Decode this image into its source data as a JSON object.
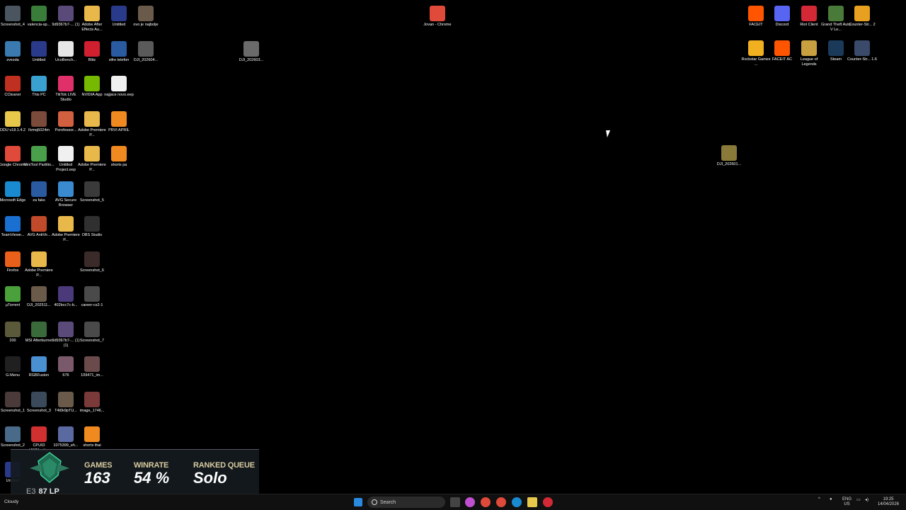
{
  "desktop_icons": [
    {
      "label": "Screenshot_4",
      "color": "#4a5560"
    },
    {
      "label": "valencia-sp...",
      "color": "#3a7d3a"
    },
    {
      "label": "9d9367b7-... (1)",
      "color": "#5a4a7a"
    },
    {
      "label": "Adobe After Effects Au...",
      "color": "#e8b84a"
    },
    {
      "label": "Untitled",
      "color": "#2a3a8a"
    },
    {
      "label": "ovo je najbolje",
      "color": "#6a5a4a"
    },
    {
      "label": "zvezda",
      "color": "#3a7ab0"
    },
    {
      "label": "Untitled",
      "color": "#2a3a8a"
    },
    {
      "label": "UcoBench...",
      "color": "#e8e8e8"
    },
    {
      "label": "Blitz",
      "color": "#d02030"
    },
    {
      "label": "sifre telefon",
      "color": "#2a5aa0"
    },
    {
      "label": "DJI_202604...",
      "color": "#5a5a5a"
    },
    {
      "label": "CCleaner",
      "color": "#c03020"
    },
    {
      "label": "This PC",
      "color": "#3aa0d0"
    },
    {
      "label": "TikTok LIVE Studio",
      "color": "#e0306a"
    },
    {
      "label": "NVIDIA App",
      "color": "#76b900"
    },
    {
      "label": "najjace novo.eep",
      "color": "#f0f0f0"
    },
    {
      "label": "DDU v18.1.4.2",
      "color": "#e8c84a"
    },
    {
      "label": "Ilvmq5024m",
      "color": "#7a4a3a"
    },
    {
      "label": "Porofessor...",
      "color": "#d06040"
    },
    {
      "label": "Adobe Premiere P...",
      "color": "#e8b84a"
    },
    {
      "label": "PRVI APRIL",
      "color": "#f08a20"
    },
    {
      "label": "Google Chrome",
      "color": "#e04a3a"
    },
    {
      "label": "MiniTool Partitio...",
      "color": "#4aa04a"
    },
    {
      "label": "Untitled Project.eep",
      "color": "#f0f0f0"
    },
    {
      "label": "Adobe Premiere P...",
      "color": "#e8b84a"
    },
    {
      "label": "shorts pa",
      "color": "#f08a20"
    },
    {
      "label": "Microsoft Edge",
      "color": "#1a8ad0"
    },
    {
      "label": "za faks",
      "color": "#2a5aa0"
    },
    {
      "label": "AVG Secure Browser",
      "color": "#3a8ad0"
    },
    {
      "label": "Screenshot_5",
      "color": "#3a3a3a"
    },
    {
      "label": "TeamViewe...",
      "color": "#1a70d0"
    },
    {
      "label": "AVG AntiVir...",
      "color": "#c04a2a"
    },
    {
      "label": "Adobe Premiere P...",
      "color": "#e8b84a"
    },
    {
      "label": "OBS Studio",
      "color": "#303030"
    },
    {
      "label": "Firefox",
      "color": "#e8601a"
    },
    {
      "label": "Adobe Premiere P...",
      "color": "#e8b84a"
    },
    {
      "label": "Screenshot_6",
      "color": "#3a2a2a"
    },
    {
      "label": "µTorrent",
      "color": "#4aa03a"
    },
    {
      "label": "DJI_202511...",
      "color": "#6a5a4a"
    },
    {
      "label": "402bcc7c-b...",
      "color": "#4a3a7a"
    },
    {
      "label": "career-cs2-1",
      "color": "#4a4a4a"
    },
    {
      "label": "200",
      "color": "#5a5a3a"
    },
    {
      "label": "MSI Afterburner",
      "color": "#3a6a3a"
    },
    {
      "label": "9d9367b7-... (1) (1)",
      "color": "#5a4a7a"
    },
    {
      "label": "Screenshot_7",
      "color": "#4a4a4a"
    },
    {
      "label": "G-Menu",
      "color": "#202020"
    },
    {
      "label": "RGBFusion",
      "color": "#4a90d0"
    },
    {
      "label": "676",
      "color": "#7a5a6a"
    },
    {
      "label": "109471_im...",
      "color": "#6a4a4a"
    },
    {
      "label": "Screenshot_1",
      "color": "#4a3a3a"
    },
    {
      "label": "Screenshot_3",
      "color": "#3a4a5a"
    },
    {
      "label": "T4t0k9pTU...",
      "color": "#6a5a4a"
    },
    {
      "label": "image_1746...",
      "color": "#7a3a3a"
    },
    {
      "label": "Screenshot_2",
      "color": "#4a6a8a"
    },
    {
      "label": "CPUID HWMonitor",
      "color": "#d03030"
    },
    {
      "label": "1075399_eh...",
      "color": "#5a6aa0"
    },
    {
      "label": "shorts thai",
      "color": "#f08a20"
    },
    {
      "label": "Untitled",
      "color": "#2a3a8a"
    },
    {
      "label": "DJI_202603...",
      "color": "#6a6a6a"
    },
    {
      "label": "Jovan - Chrome",
      "color": "#e04a3a"
    },
    {
      "label": "FACEIT",
      "color": "#ff5500"
    },
    {
      "label": "Discord",
      "color": "#5865f2"
    },
    {
      "label": "Riot Client",
      "color": "#d32936"
    },
    {
      "label": "Grand Theft Auto V Le...",
      "color": "#4a7a3a"
    },
    {
      "label": "Counter-Str... 2",
      "color": "#e8a020"
    },
    {
      "label": "Rockstar Games ...",
      "color": "#f0b020"
    },
    {
      "label": "FACEIT AC",
      "color": "#ff5500"
    },
    {
      "label": "League of Legends",
      "color": "#c8a040"
    },
    {
      "label": "Steam",
      "color": "#1b3a5a"
    },
    {
      "label": "Counter-Str... 1.6",
      "color": "#3a4a6a"
    },
    {
      "label": "DJI_202601...",
      "color": "#8a7a3a"
    }
  ],
  "overlay": {
    "rank_tier": "E3",
    "lp": "87 LP",
    "stats": [
      {
        "heading": "GAMES",
        "value": "163"
      },
      {
        "heading": "WINRATE",
        "value": "54 %"
      },
      {
        "heading": "RANKED QUEUE",
        "value": "Solo"
      }
    ]
  },
  "taskbar": {
    "weather": "Cloudy",
    "search_placeholder": "Search",
    "language": "ENG",
    "region": "US",
    "time": "19:25",
    "date": "14/04/2026"
  }
}
